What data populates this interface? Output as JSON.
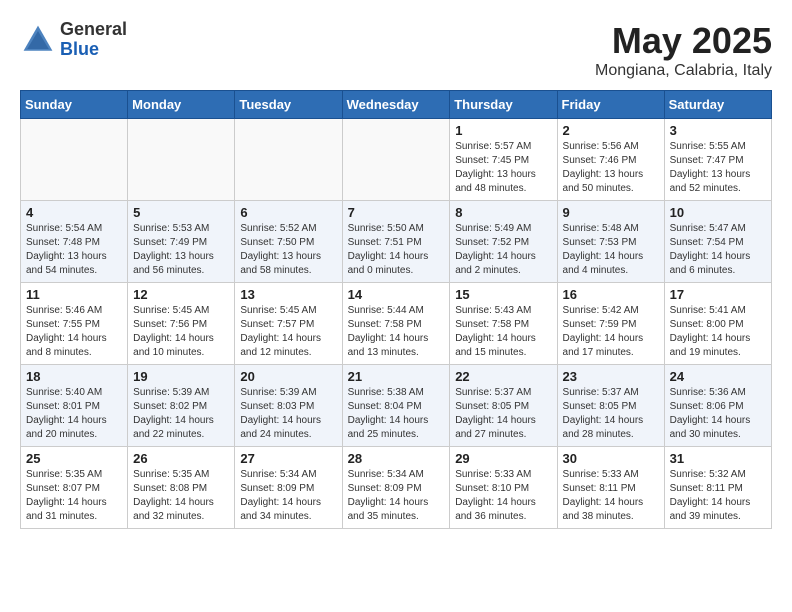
{
  "header": {
    "logo_general": "General",
    "logo_blue": "Blue",
    "month_title": "May 2025",
    "location": "Mongiana, Calabria, Italy"
  },
  "weekdays": [
    "Sunday",
    "Monday",
    "Tuesday",
    "Wednesday",
    "Thursday",
    "Friday",
    "Saturday"
  ],
  "weeks": [
    [
      {
        "day": "",
        "info": ""
      },
      {
        "day": "",
        "info": ""
      },
      {
        "day": "",
        "info": ""
      },
      {
        "day": "",
        "info": ""
      },
      {
        "day": "1",
        "info": "Sunrise: 5:57 AM\nSunset: 7:45 PM\nDaylight: 13 hours\nand 48 minutes."
      },
      {
        "day": "2",
        "info": "Sunrise: 5:56 AM\nSunset: 7:46 PM\nDaylight: 13 hours\nand 50 minutes."
      },
      {
        "day": "3",
        "info": "Sunrise: 5:55 AM\nSunset: 7:47 PM\nDaylight: 13 hours\nand 52 minutes."
      }
    ],
    [
      {
        "day": "4",
        "info": "Sunrise: 5:54 AM\nSunset: 7:48 PM\nDaylight: 13 hours\nand 54 minutes."
      },
      {
        "day": "5",
        "info": "Sunrise: 5:53 AM\nSunset: 7:49 PM\nDaylight: 13 hours\nand 56 minutes."
      },
      {
        "day": "6",
        "info": "Sunrise: 5:52 AM\nSunset: 7:50 PM\nDaylight: 13 hours\nand 58 minutes."
      },
      {
        "day": "7",
        "info": "Sunrise: 5:50 AM\nSunset: 7:51 PM\nDaylight: 14 hours\nand 0 minutes."
      },
      {
        "day": "8",
        "info": "Sunrise: 5:49 AM\nSunset: 7:52 PM\nDaylight: 14 hours\nand 2 minutes."
      },
      {
        "day": "9",
        "info": "Sunrise: 5:48 AM\nSunset: 7:53 PM\nDaylight: 14 hours\nand 4 minutes."
      },
      {
        "day": "10",
        "info": "Sunrise: 5:47 AM\nSunset: 7:54 PM\nDaylight: 14 hours\nand 6 minutes."
      }
    ],
    [
      {
        "day": "11",
        "info": "Sunrise: 5:46 AM\nSunset: 7:55 PM\nDaylight: 14 hours\nand 8 minutes."
      },
      {
        "day": "12",
        "info": "Sunrise: 5:45 AM\nSunset: 7:56 PM\nDaylight: 14 hours\nand 10 minutes."
      },
      {
        "day": "13",
        "info": "Sunrise: 5:45 AM\nSunset: 7:57 PM\nDaylight: 14 hours\nand 12 minutes."
      },
      {
        "day": "14",
        "info": "Sunrise: 5:44 AM\nSunset: 7:58 PM\nDaylight: 14 hours\nand 13 minutes."
      },
      {
        "day": "15",
        "info": "Sunrise: 5:43 AM\nSunset: 7:58 PM\nDaylight: 14 hours\nand 15 minutes."
      },
      {
        "day": "16",
        "info": "Sunrise: 5:42 AM\nSunset: 7:59 PM\nDaylight: 14 hours\nand 17 minutes."
      },
      {
        "day": "17",
        "info": "Sunrise: 5:41 AM\nSunset: 8:00 PM\nDaylight: 14 hours\nand 19 minutes."
      }
    ],
    [
      {
        "day": "18",
        "info": "Sunrise: 5:40 AM\nSunset: 8:01 PM\nDaylight: 14 hours\nand 20 minutes."
      },
      {
        "day": "19",
        "info": "Sunrise: 5:39 AM\nSunset: 8:02 PM\nDaylight: 14 hours\nand 22 minutes."
      },
      {
        "day": "20",
        "info": "Sunrise: 5:39 AM\nSunset: 8:03 PM\nDaylight: 14 hours\nand 24 minutes."
      },
      {
        "day": "21",
        "info": "Sunrise: 5:38 AM\nSunset: 8:04 PM\nDaylight: 14 hours\nand 25 minutes."
      },
      {
        "day": "22",
        "info": "Sunrise: 5:37 AM\nSunset: 8:05 PM\nDaylight: 14 hours\nand 27 minutes."
      },
      {
        "day": "23",
        "info": "Sunrise: 5:37 AM\nSunset: 8:05 PM\nDaylight: 14 hours\nand 28 minutes."
      },
      {
        "day": "24",
        "info": "Sunrise: 5:36 AM\nSunset: 8:06 PM\nDaylight: 14 hours\nand 30 minutes."
      }
    ],
    [
      {
        "day": "25",
        "info": "Sunrise: 5:35 AM\nSunset: 8:07 PM\nDaylight: 14 hours\nand 31 minutes."
      },
      {
        "day": "26",
        "info": "Sunrise: 5:35 AM\nSunset: 8:08 PM\nDaylight: 14 hours\nand 32 minutes."
      },
      {
        "day": "27",
        "info": "Sunrise: 5:34 AM\nSunset: 8:09 PM\nDaylight: 14 hours\nand 34 minutes."
      },
      {
        "day": "28",
        "info": "Sunrise: 5:34 AM\nSunset: 8:09 PM\nDaylight: 14 hours\nand 35 minutes."
      },
      {
        "day": "29",
        "info": "Sunrise: 5:33 AM\nSunset: 8:10 PM\nDaylight: 14 hours\nand 36 minutes."
      },
      {
        "day": "30",
        "info": "Sunrise: 5:33 AM\nSunset: 8:11 PM\nDaylight: 14 hours\nand 38 minutes."
      },
      {
        "day": "31",
        "info": "Sunrise: 5:32 AM\nSunset: 8:11 PM\nDaylight: 14 hours\nand 39 minutes."
      }
    ]
  ]
}
